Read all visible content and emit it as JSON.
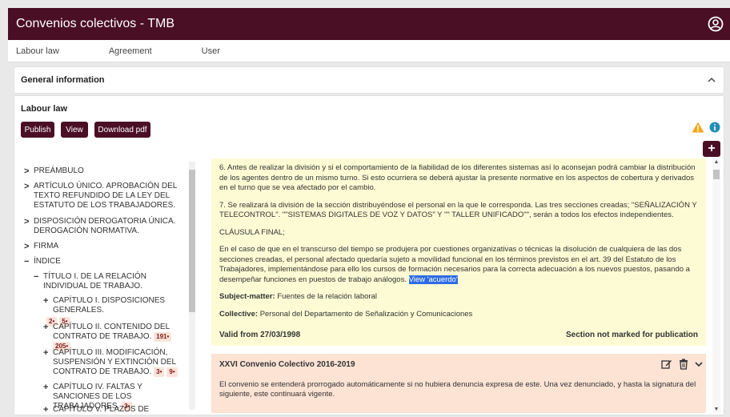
{
  "app": {
    "title": "Convenios colectivos - TMB"
  },
  "nav": [
    "Labour law",
    "Agreement",
    "User"
  ],
  "general": {
    "title": "General information"
  },
  "labour": {
    "title": "Labour law",
    "buttons": {
      "publish": "Publish",
      "view": "View",
      "download": "Download pdf"
    }
  },
  "tree": {
    "items": [
      {
        "sym": ">",
        "text": "PREÁMBULO"
      },
      {
        "sym": ">",
        "text": "ARTÍCULO ÚNICO. APROBACIÓN DEL TEXTO REFUNDIDO DE LA LEY DEL ESTATUTO DE LOS TRABAJADORES."
      },
      {
        "sym": ">",
        "text": "DISPOSICIÓN DEROGATORIA ÚNICA. DEROGACIÓN NORMATIVA."
      },
      {
        "sym": ">",
        "text": "FIRMA"
      },
      {
        "sym": "−",
        "text": "ÍNDICE"
      },
      {
        "sym": "−",
        "text": "TÍTULO I. DE LA RELACIÓN INDIVIDUAL DE TRABAJO."
      },
      {
        "sym": "+",
        "text": "CAPÍTULO I. DISPOSICIONES GENERALES.",
        "badges": [
          "2•",
          "5•"
        ]
      },
      {
        "sym": "+",
        "text": "CAPÍTULO II. CONTENIDO DEL CONTRATO DE TRABAJO.",
        "badges": [
          "191•",
          "205•"
        ]
      },
      {
        "sym": "+",
        "text": "CAPÍTULO III. MODIFICACIÓN, SUSPENSIÓN Y EXTINCIÓN DEL CONTRATO DE TRABAJO.",
        "badges": [
          "3•",
          "9•"
        ]
      },
      {
        "sym": "+",
        "text": "CAPÍTULO IV. FALTAS Y SANCIONES DE LOS TRABAJADORES.",
        "badges": [
          "3•"
        ]
      },
      {
        "sym": "+",
        "text": "CAPÍTULO V. PLAZOS DE PRESCRIPCIÓN."
      }
    ]
  },
  "entry1": {
    "p1": "6. Antes de realizar la división y si el comportamiento de la fiabilidad de los diferentes sistemas así lo aconsejan podrá cambiar la distribución de los agentes dentro de un mismo turno. Si esto ocurriera se deberá ajustar la presente normative en los aspectos de cobertura y derivados en el turno que se vea afectado por el cambio.",
    "p2": "7. Se realizará la división de la sección distribuyéndose el personal en la que le corresponda. Las tres secciones creadas; \"SEÑALIZACIÓN Y TELECONTROL\". \"\"SISTEMAS DIGITALES DE VOZ Y DATOS\" Y \"\" TALLER UNIFICADO\"\", serán a todos los efectos independientes.",
    "p3": "CLÁUSULA FINAL;",
    "p4": "En el caso de que en el transcurso del tiempo se produjera por cuestiones organizativas o técnicas la disolución de cualquiera de las dos secciones creadas, el personal afectado quedaría sujeto a movilidad funcional en los términos previstos en el art. 39 del Estatuto de los Trabajadores, implementándose para ello los cursos de formación necesarios para la correcta adecuación a los nuevos puestos, pasando a desempeñar funciones en puestos de trabajo análogos.",
    "selected": "View 'acuerdo'",
    "subject_label": "Subject-matter:",
    "subject_value": "Fuentes de la relación laboral",
    "collective_label": "Collective:",
    "collective_value": "Personal del Departamento de Señalización y Comunicaciones",
    "valid": "Valid from 27/03/1998",
    "status": "Section not marked for publication"
  },
  "entry2": {
    "title": "XXVI Convenio Colectivo 2016-2019",
    "text": "El convenio se entenderá prorrogado automáticamente si no hubiera denuncia expresa de este. Una vez denunciado, y hasta la signatura del siguiente, este continuará vigente."
  },
  "colors": {
    "brand": "#4a0f25",
    "yellow": "#fdfbd4",
    "orange": "#fce3d4",
    "selection": "#2e6ce6"
  }
}
